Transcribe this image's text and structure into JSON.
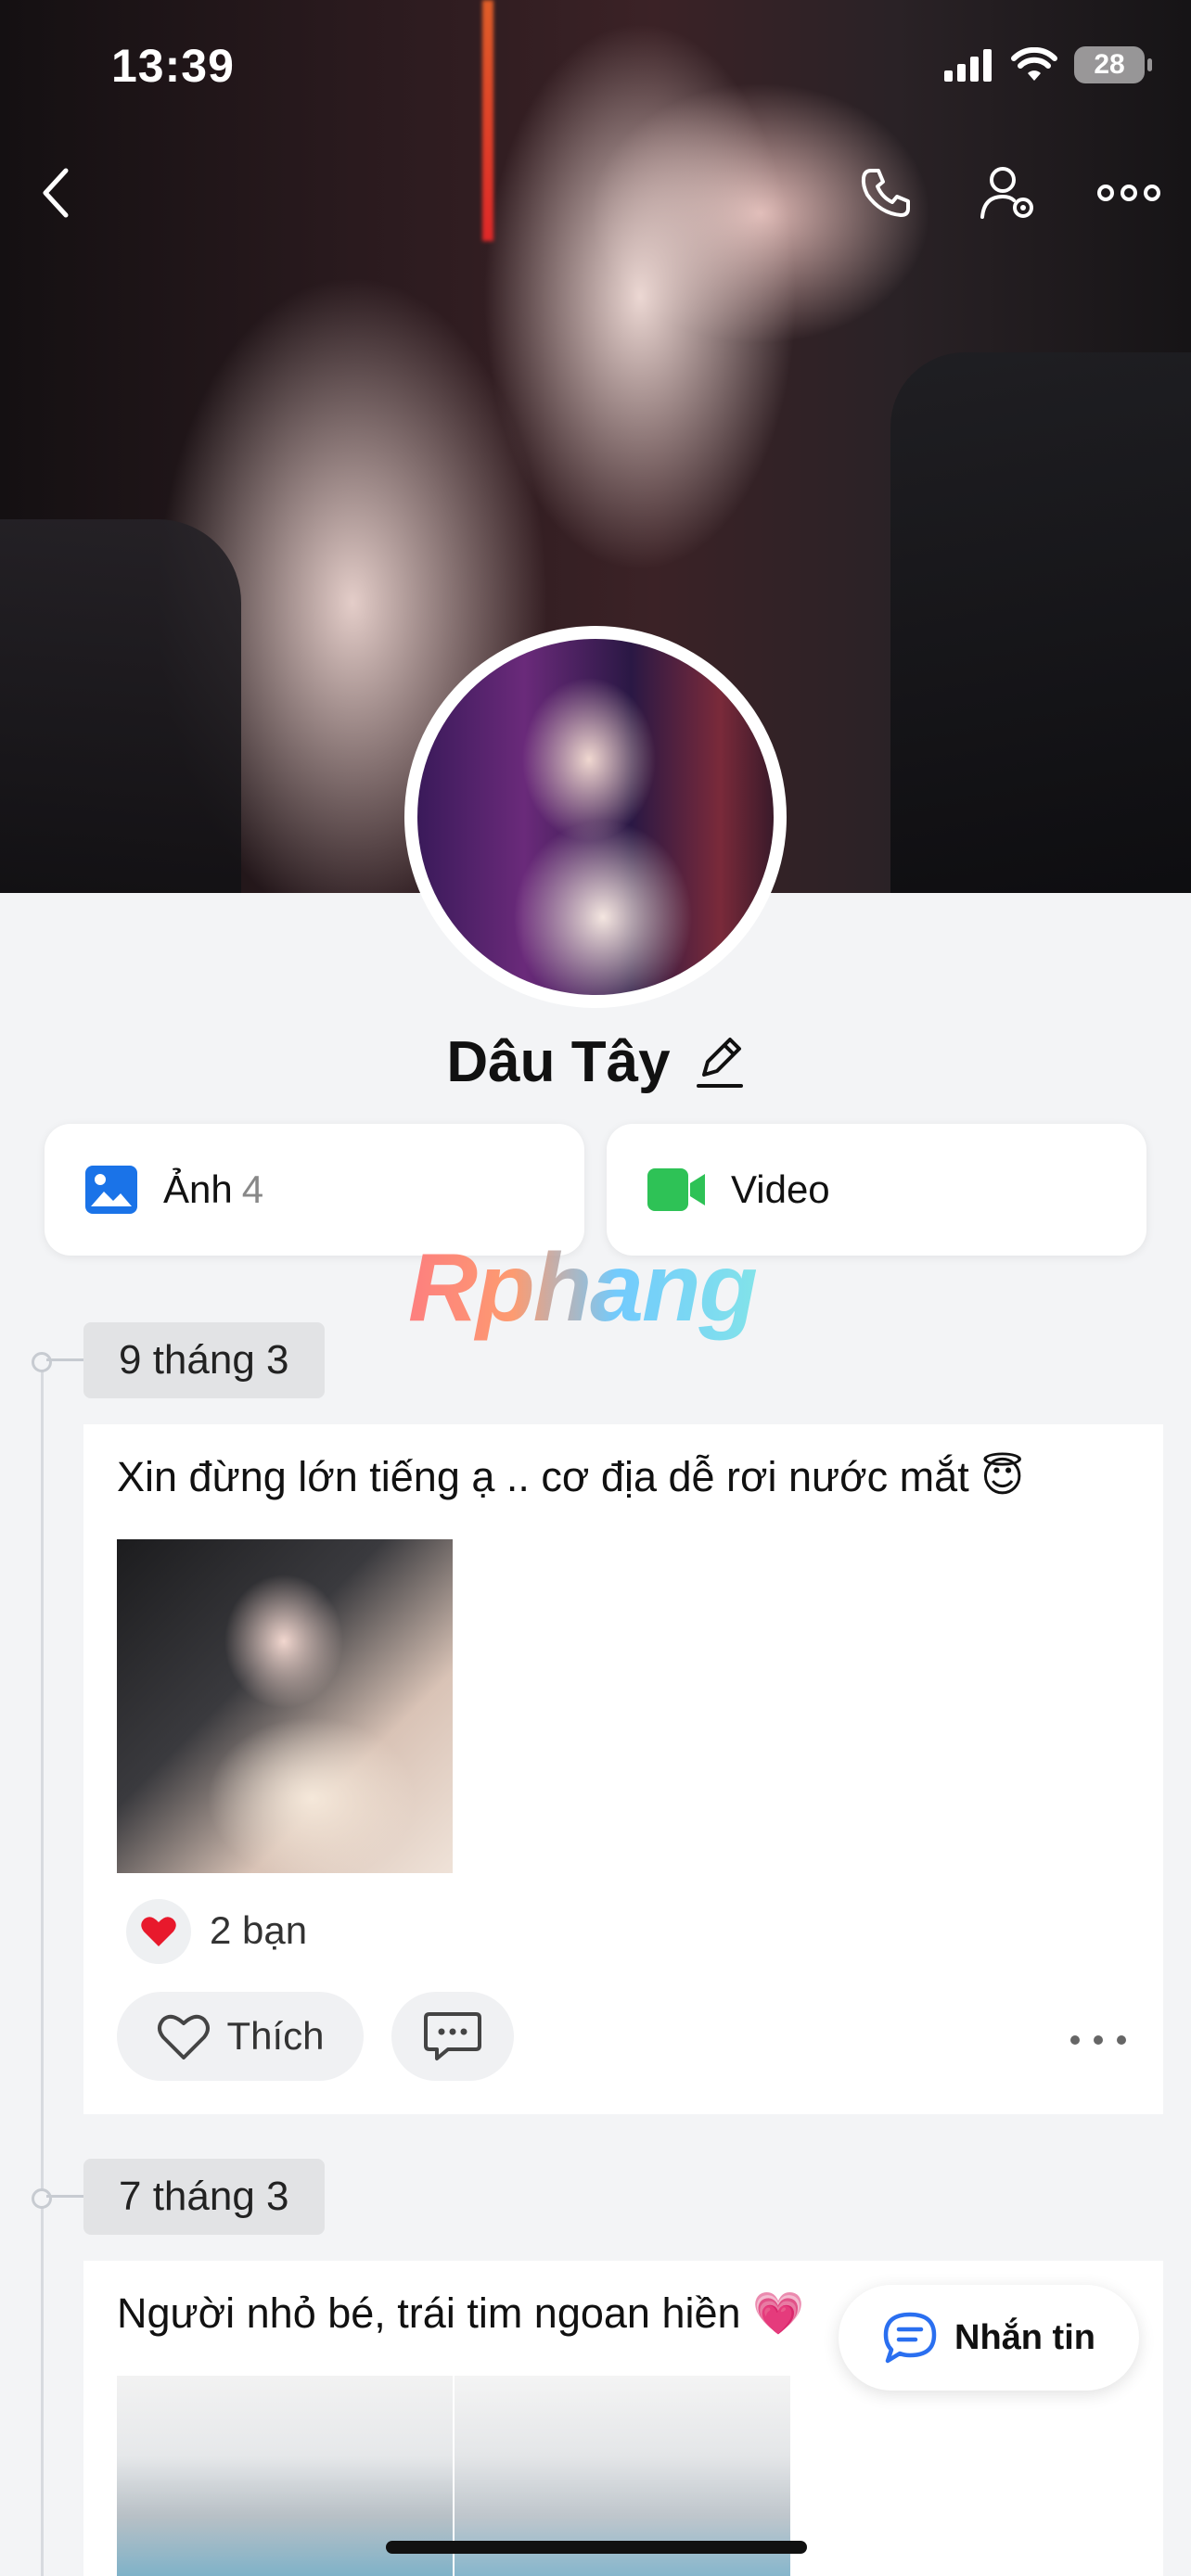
{
  "status": {
    "time": "13:39",
    "battery": "28"
  },
  "profile": {
    "name": "Dâu Tây"
  },
  "media": {
    "photos_label": "Ảnh",
    "photos_count": "4",
    "video_label": "Video"
  },
  "watermark": "Rphang",
  "posts": [
    {
      "date": "9 tháng 3",
      "text": "Xin đừng lớn tiếng ạ .. cơ địa dễ rơi nước mắt 😇",
      "reactions": "2 bạn",
      "like_label": "Thích"
    },
    {
      "date": "7 tháng 3",
      "text": "Người nhỏ bé, trái tim ngoan hiền 💗"
    }
  ],
  "message_button": "Nhắn tin",
  "colors": {
    "photo_icon": "#1a73e8",
    "video_icon": "#2ec256",
    "reaction_heart": "#e8192c",
    "message_icon": "#2a6ff0",
    "background": "#f3f4f6"
  },
  "icons": [
    "back-icon",
    "phone-icon",
    "user-settings-icon",
    "more-icon",
    "photo-icon",
    "video-icon",
    "edit-icon",
    "heart-icon",
    "comment-icon",
    "message-icon"
  ]
}
